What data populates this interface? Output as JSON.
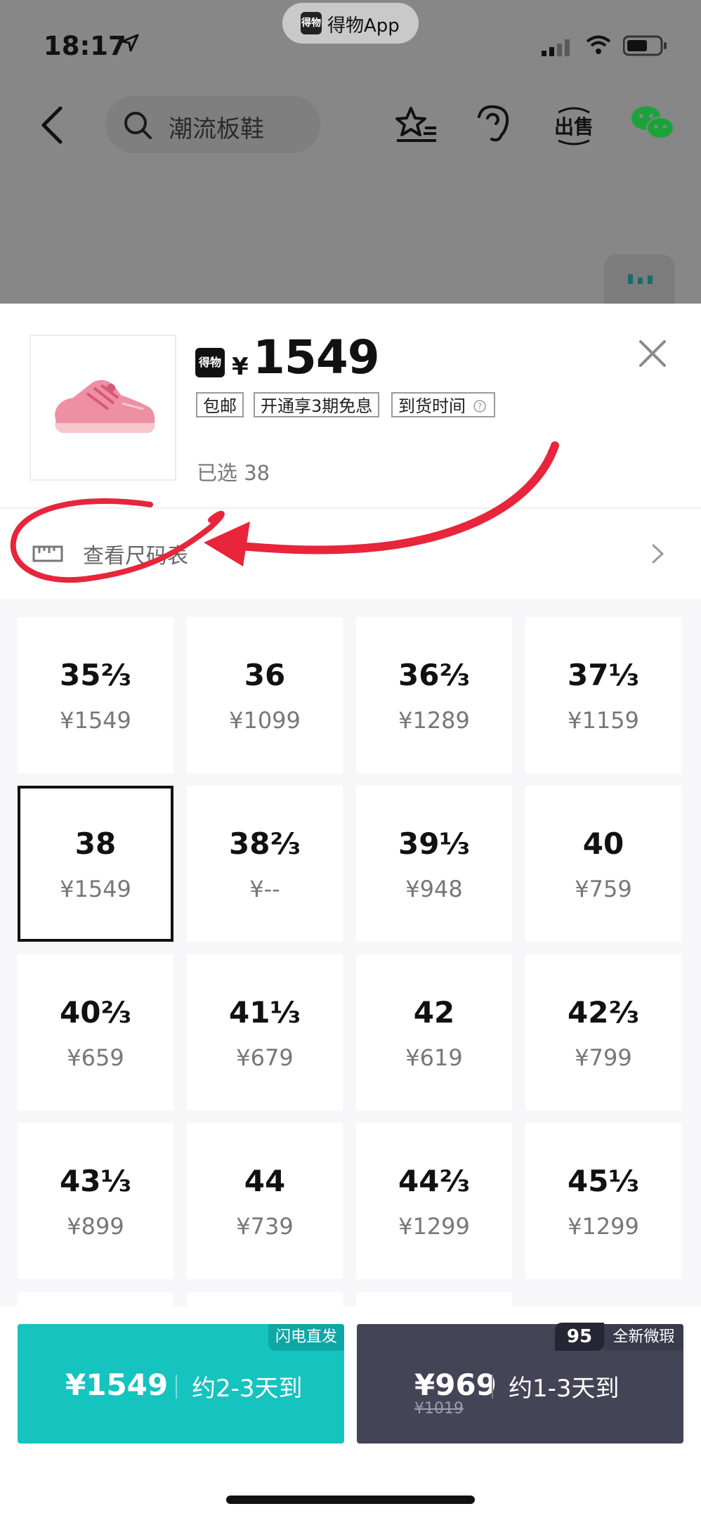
{
  "status_bar": {
    "time": "18:17",
    "app_pill": "得物App",
    "app_logo": "得物"
  },
  "nav": {
    "search_placeholder": "潮流板鞋"
  },
  "product": {
    "logo": "得物",
    "currency": "¥",
    "price": "1549",
    "tags": [
      "包邮",
      "开通享3期免息",
      "到货时间"
    ],
    "selected": "已选 38"
  },
  "size_chart": {
    "label": "查看尺码表"
  },
  "sizes": [
    {
      "size": "35⅔",
      "price": "¥1549"
    },
    {
      "size": "36",
      "price": "¥1099"
    },
    {
      "size": "36⅔",
      "price": "¥1289"
    },
    {
      "size": "37⅓",
      "price": "¥1159"
    },
    {
      "size": "38",
      "price": "¥1549",
      "selected": true
    },
    {
      "size": "38⅔",
      "price": "¥--"
    },
    {
      "size": "39⅓",
      "price": "¥948"
    },
    {
      "size": "40",
      "price": "¥759"
    },
    {
      "size": "40⅔",
      "price": "¥659"
    },
    {
      "size": "41⅓",
      "price": "¥679"
    },
    {
      "size": "42",
      "price": "¥619"
    },
    {
      "size": "42⅔",
      "price": "¥799"
    },
    {
      "size": "43⅓",
      "price": "¥899"
    },
    {
      "size": "44",
      "price": "¥739"
    },
    {
      "size": "44⅔",
      "price": "¥1299"
    },
    {
      "size": "45⅓",
      "price": "¥1299"
    }
  ],
  "buy_buttons": {
    "flash": {
      "badge": "闪电直发",
      "price": "¥1549",
      "delivery": "约2-3天到"
    },
    "new": {
      "badge_score": "95",
      "badge": "全新微瑕",
      "price": "¥969",
      "original_price": "¥1019",
      "delivery": "约1-3天到"
    }
  },
  "colors": {
    "flash": "#15c3bf",
    "new": "#434456",
    "annotation": "#e8253a"
  }
}
